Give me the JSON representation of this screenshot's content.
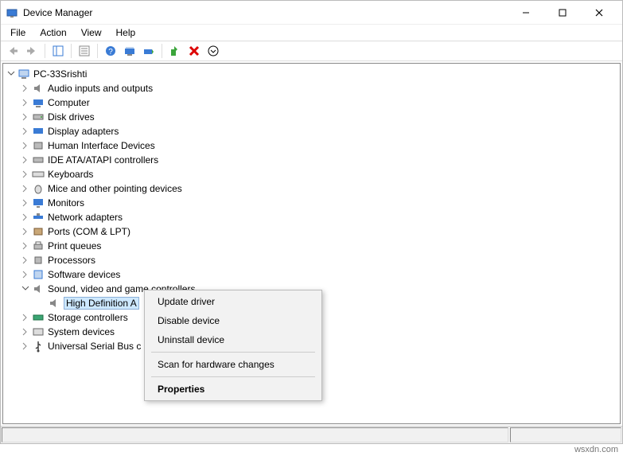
{
  "title": "Device Manager",
  "menu": {
    "file": "File",
    "action": "Action",
    "view": "View",
    "help": "Help"
  },
  "root": "PC-33Srishti",
  "devices": {
    "audio": "Audio inputs and outputs",
    "computer": "Computer",
    "disk": "Disk drives",
    "display": "Display adapters",
    "hid": "Human Interface Devices",
    "ide": "IDE ATA/ATAPI controllers",
    "keyboards": "Keyboards",
    "mice": "Mice and other pointing devices",
    "monitors": "Monitors",
    "network": "Network adapters",
    "ports": "Ports (COM & LPT)",
    "print": "Print queues",
    "processors": "Processors",
    "software": "Software devices",
    "sound": "Sound, video and game controllers",
    "sound_child": "High Definition A",
    "storage": "Storage controllers",
    "system": "System devices",
    "usb": "Universal Serial Bus c"
  },
  "context_menu": {
    "update": "Update driver",
    "disable": "Disable device",
    "uninstall": "Uninstall device",
    "scan": "Scan for hardware changes",
    "props": "Properties"
  },
  "watermark": "wsxdn.com"
}
